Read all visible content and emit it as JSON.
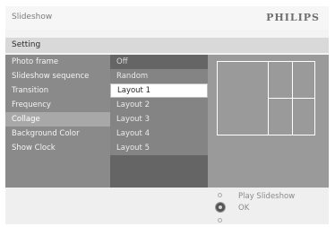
{
  "header": {
    "title": "Slideshow",
    "brand": "PHILIPS"
  },
  "setting_bar": {
    "label": "Setting"
  },
  "menu": {
    "items": [
      {
        "label": "Photo frame"
      },
      {
        "label": "Slideshow sequence"
      },
      {
        "label": "Transition"
      },
      {
        "label": "Frequency"
      },
      {
        "label": "Collage"
      },
      {
        "label": "Background Color"
      },
      {
        "label": "Show Clock"
      }
    ],
    "selected": "Collage"
  },
  "options": {
    "items": [
      {
        "label": "Off"
      },
      {
        "label": "Random"
      },
      {
        "label": "Layout 1"
      },
      {
        "label": "Layout 2"
      },
      {
        "label": "Layout 3"
      },
      {
        "label": "Layout 4"
      },
      {
        "label": "Layout 5"
      }
    ],
    "selected": "Layout 1"
  },
  "footer": {
    "hint_play": "Play Slideshow",
    "hint_ok": "OK"
  },
  "colors": {
    "menu_bg": "#8a8a8a",
    "menu_selected": "#a8a8a8",
    "options_bg": "#656565",
    "preview_bg": "#9a9a9a"
  }
}
